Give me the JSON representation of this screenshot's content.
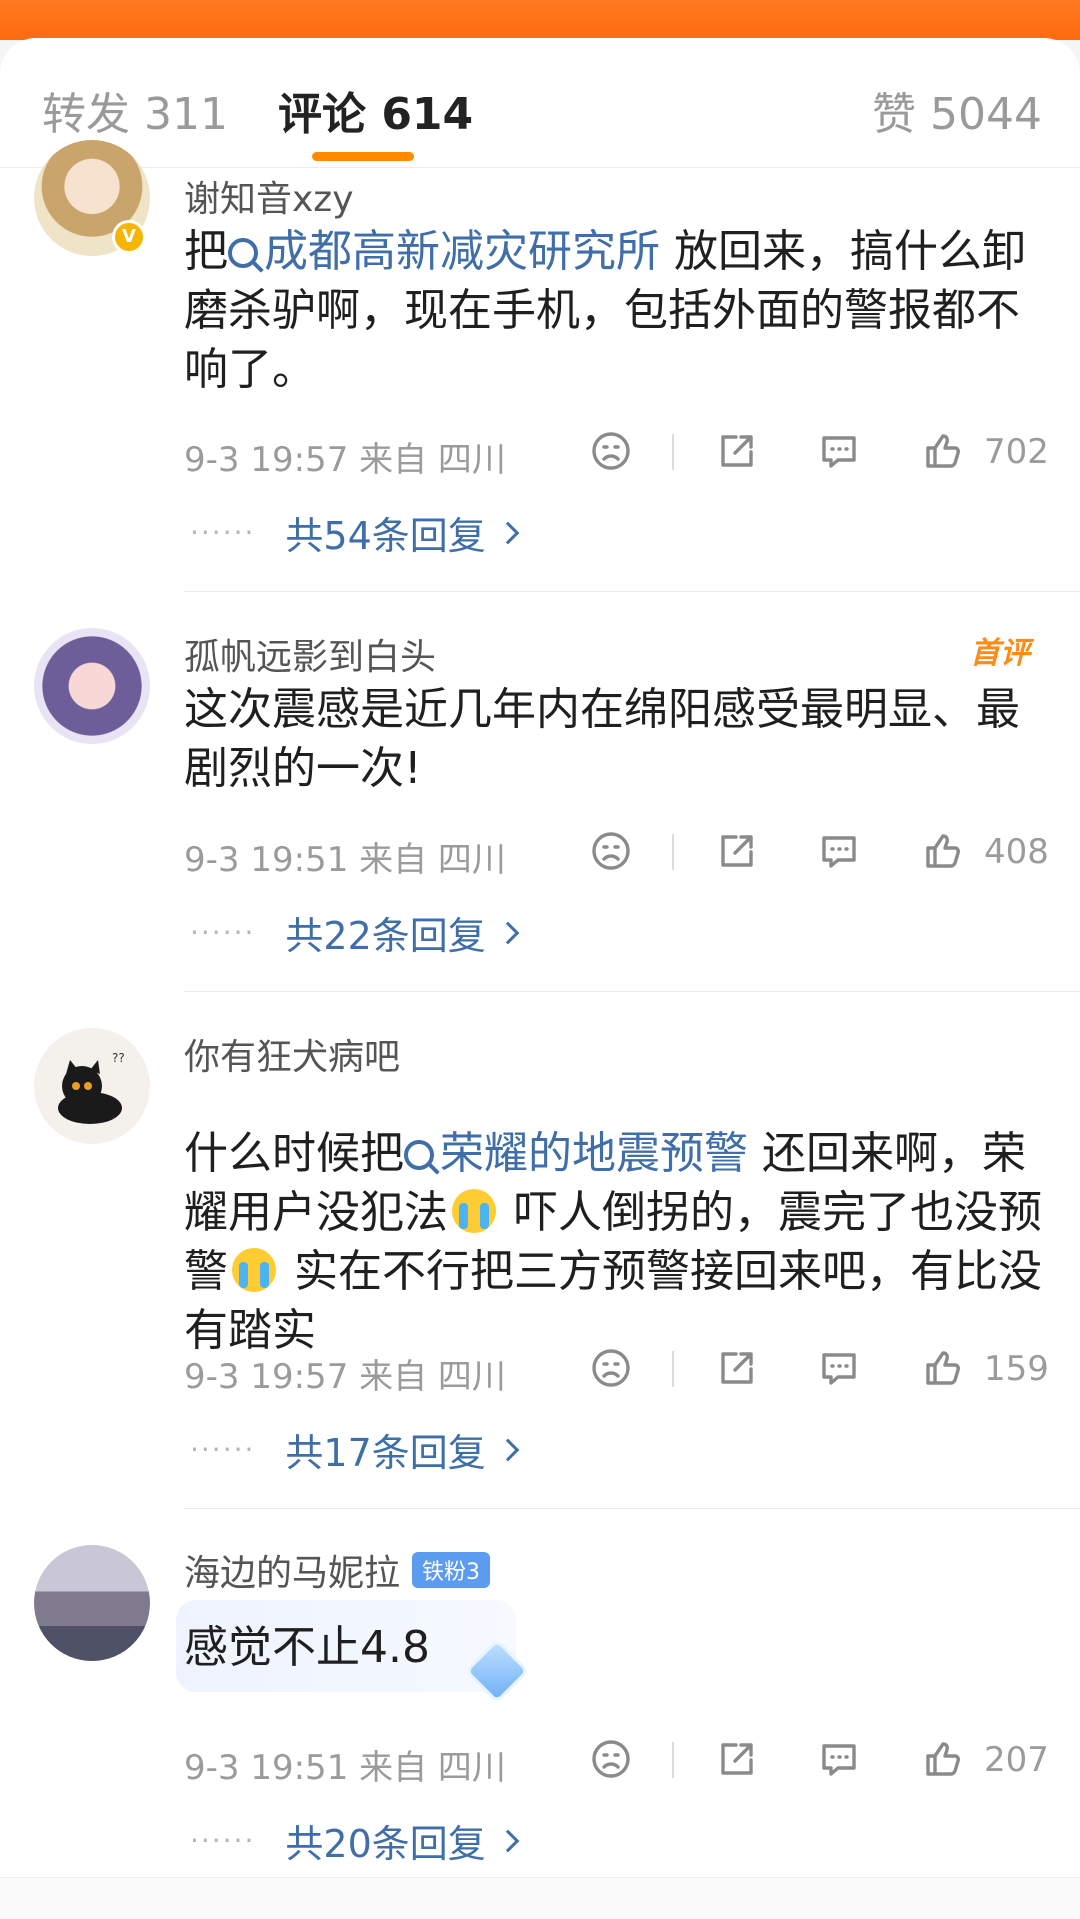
{
  "tabs": {
    "repost": "转发 311",
    "comments": "评论 614",
    "likes": "赞 5044"
  },
  "comments": [
    {
      "username": "谢知音xzy",
      "verified": true,
      "text_before": "把",
      "hashtag": "成都高新减灾研究所",
      "text_after": " 放回来，搞什么卸磨杀驴啊，现在手机，包括外面的警报都不响了。",
      "time_location": "9-3 19:57  来自 四川",
      "likes": "702",
      "replies": "共54条回复"
    },
    {
      "username": "孤帆远影到白头",
      "badge": "首评",
      "text": "这次震感是近几年内在绵阳感受最明显、最剧烈的一次!",
      "time_location": "9-3 19:51  来自 四川",
      "likes": "408",
      "replies": "共22条回复"
    },
    {
      "username": "你有狂犬病吧",
      "text_before": "什么时候把",
      "hashtag": "荣耀的地震预警",
      "text_mid1": " 还回来啊，荣耀用户没犯法",
      "text_mid2": " 吓人倒拐的，震完了也没预警",
      "text_after": " 实在不行把三方预警接回来吧，有比没有踏实",
      "time_location": "9-3 19:57  来自 四川",
      "likes": "159",
      "replies": "共17条回复"
    },
    {
      "username": "海边的马妮拉",
      "fan_badge": "铁粉3",
      "text": "感觉不止4.8",
      "time_location": "9-3 19:51  来自 四川",
      "likes": "207",
      "replies": "共20条回复"
    }
  ],
  "icons": {
    "tab_indicator_color": "#ff8a00",
    "link_color": "#3f6ea8"
  }
}
